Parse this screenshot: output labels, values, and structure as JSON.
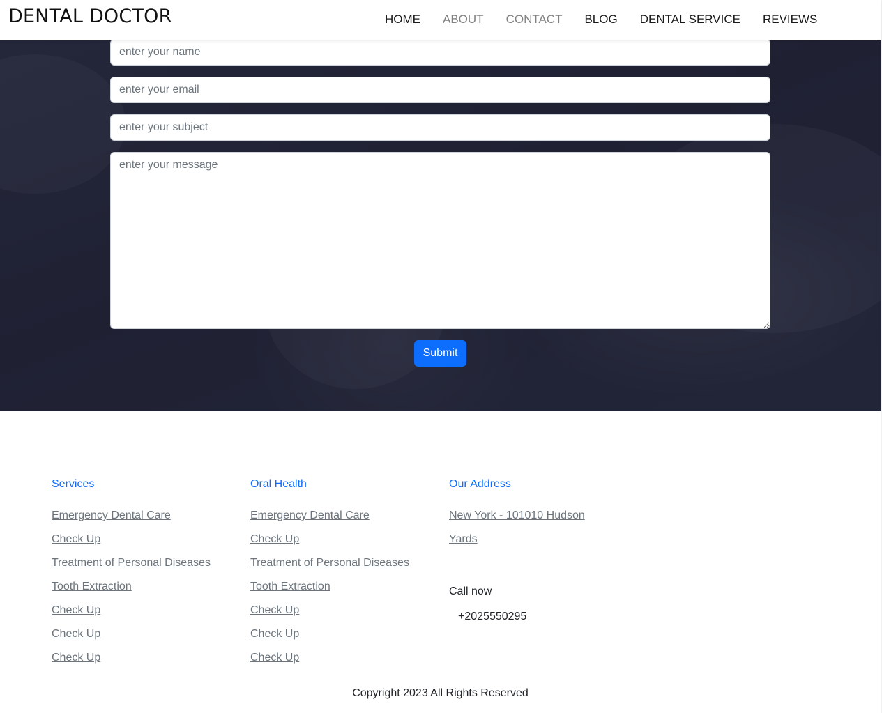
{
  "navbar": {
    "brand": "DENTAL DOCTOR",
    "links": [
      "HOME",
      "ABOUT",
      "CONTACT",
      "BLOG",
      "DENTAL SERVICE",
      "REVIEWS"
    ]
  },
  "form": {
    "name_placeholder": "enter your name",
    "email_placeholder": "enter your email",
    "subject_placeholder": "enter your subject",
    "message_placeholder": "enter your message",
    "submit_label": "Submit"
  },
  "footer": {
    "services": {
      "heading": "Services",
      "links": [
        "Emergency Dental Care",
        "Check Up",
        "Treatment of Personal Diseases",
        "Tooth Extraction",
        "Check Up",
        "Check Up",
        "Check Up"
      ]
    },
    "oral_health": {
      "heading": "Oral Health",
      "links": [
        "Emergency Dental Care",
        "Check Up",
        "Treatment of Personal Diseases",
        "Tooth Extraction",
        "Check Up",
        "Check Up",
        "Check Up"
      ]
    },
    "address": {
      "heading": "Our Address",
      "address_text": "New York - 101010 Hudson Yards",
      "call_label": "Call now",
      "phone": "+2025550295"
    },
    "copyright": "Copyright 2023 All Rights Reserved"
  },
  "colors": {
    "accent": "#0d6efd",
    "hero_bg": "#22253a",
    "muted_link": "#6c757d"
  }
}
